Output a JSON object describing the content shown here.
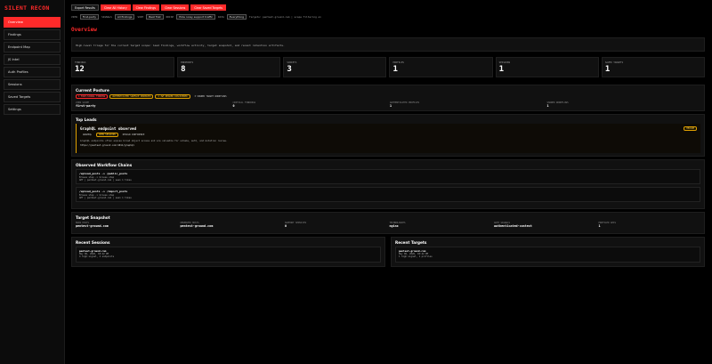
{
  "brand": "SILENT RECON",
  "nav": [
    {
      "label": "Overview",
      "active": true
    },
    {
      "label": "Findings"
    },
    {
      "label": "Endpoint Map"
    },
    {
      "label": "JS Intel"
    },
    {
      "label": "Auth Profiles"
    },
    {
      "label": "Sessions"
    },
    {
      "label": "Saved Targets"
    },
    {
      "label": "Settings"
    }
  ],
  "toolbar": {
    "export": "Export Results",
    "clear_history": "Clear All History",
    "clear_findings": "Clear Findings",
    "clear_sessions": "Clear Sessions",
    "clear_targets": "Clear Saved Targets"
  },
  "filters": {
    "view_label": "VIEW",
    "view_value": "First-party",
    "signals_label": "SIGNALS",
    "signals_value": "All findings",
    "sort_label": "SORT",
    "sort_value": "Best first",
    "noise_label": "NOISE",
    "noise_value": "Hide noisy support traffic",
    "data_label": "DATA",
    "data_value": "Everything",
    "status_text": "Targets: pentest-ground.com | scope filtering on"
  },
  "overview": {
    "title": "Overview",
    "description": "High-level triage for the current target scope: lead findings, workflow activity, target snapshot, and recent retention artifacts."
  },
  "metrics": [
    {
      "label": "FINDINGS",
      "value": "12"
    },
    {
      "label": "ENDPOINTS",
      "value": "8"
    },
    {
      "label": "SCRIPTS",
      "value": "3"
    },
    {
      "label": "PROFILES",
      "value": "1"
    },
    {
      "label": "SESSIONS",
      "value": "1"
    },
    {
      "label": "SAVED TARGETS",
      "value": "1"
    }
  ],
  "posture": {
    "title": "Current Posture",
    "badges": [
      {
        "label": "1 HIGH-SIGNAL FINDING",
        "style": "red"
      },
      {
        "label": "AUTHENTICATED SURFACE OBSERVED",
        "style": "amber"
      },
      {
        "label": "1 JWT-BEARER DISCOVERED",
        "style": "amber"
      },
      {
        "label": "3 SHARED TARGET WORKFLOWS",
        "style": "plain"
      }
    ],
    "fields": [
      {
        "label": "VIEW SCOPE",
        "value": "first-party"
      },
      {
        "label": "CRITICAL FINDINGS",
        "value": "0"
      },
      {
        "label": "AUTHENTICATED PROFILES",
        "value": "1"
      },
      {
        "label": "SHARED WORKFLOWS",
        "value": "1"
      }
    ]
  },
  "leads": {
    "title": "Top Leads",
    "item": {
      "title": "GraphQL endpoint observed",
      "severity": "MEDIUM",
      "tags": [
        "GRAPHQL",
        "OPEN SESSIONS",
        "DESIGN CONFIDENCE"
      ],
      "text": "GraphQL endpoints often expose broad object access and are valuable for schema, auth, and mutation review.",
      "url": "https://pentest-ground.com:4011/graphql"
    }
  },
  "workflows": {
    "title": "Observed Workflow Chains",
    "items": [
      {
        "title": "/upload_posts -> /public_posts",
        "line1": "Browse step -> browse step",
        "line2": "GET | pentest-ground.com | seen 1 times"
      },
      {
        "title": "/upload_posts -> /import_posts",
        "line1": "Browse step -> browse step",
        "line2": "GET | pentest-ground.com | seen 1 times"
      }
    ]
  },
  "snapshot": {
    "title": "Target Snapshot",
    "fields": [
      {
        "label": "MAIN HOSTS",
        "value": "pentest-ground.com"
      },
      {
        "label": "OBSERVED HOSTS",
        "value": "pentest-ground.com"
      },
      {
        "label": "SUPPORT SERVICES",
        "value": "0"
      },
      {
        "label": "TECHNOLOGIES",
        "value": "nginx"
      },
      {
        "label": "AUTH SIGNALS",
        "value": "authenticated-context"
      },
      {
        "label": "PROFILED APIS",
        "value": "1"
      }
    ]
  },
  "recent_sessions": {
    "title": "Recent Sessions",
    "item": {
      "title": "pentest-ground.com",
      "line1": "May 06, 2026, 03:42 PM",
      "line2": "4 high-signal, 4 endpoints"
    }
  },
  "recent_targets": {
    "title": "Recent Targets",
    "item": {
      "title": "pentest-ground.com",
      "line1": "May 06, 2026, 03:42 PM",
      "line2": "1 high-signal, 1 profiles"
    }
  },
  "colors": {
    "accent": "#ff2a2a",
    "warning": "#e0a000",
    "background": "#000000",
    "panel": "#111111"
  }
}
